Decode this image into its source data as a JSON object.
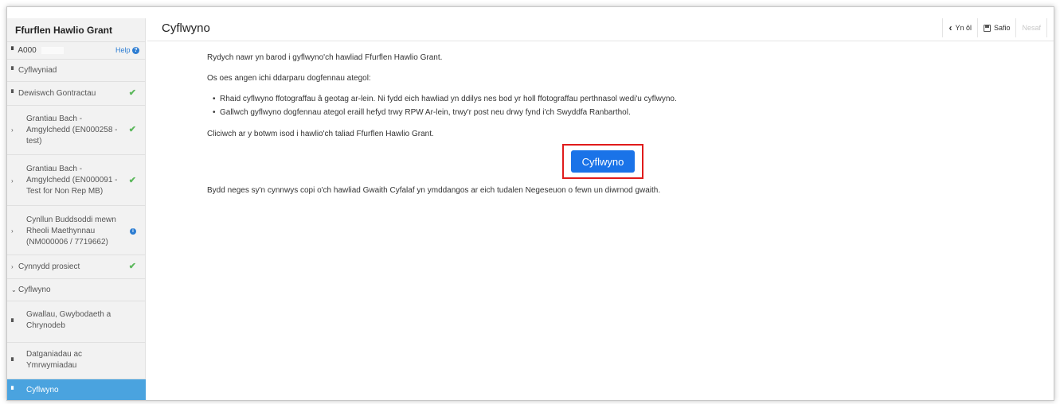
{
  "sidebar": {
    "title": "Ffurflen Hawlio Grant",
    "ref": "A000",
    "help": "Help",
    "items": [
      {
        "label": "Cyflwyniad",
        "status": ""
      },
      {
        "label": "Dewiswch Gontractau",
        "status": "complete"
      },
      {
        "label": "Grantiau Bach - Amgylchedd (EN000258 - test)",
        "status": "complete"
      },
      {
        "label": "Grantiau Bach - Amgylchedd (EN000091 - Test for Non Rep MB)",
        "status": "complete"
      },
      {
        "label": "Cynllun Buddsoddi mewn Rheoli Maethynnau (NM000006 / 7719662)",
        "status": "info"
      },
      {
        "label": "Cynnydd prosiect",
        "status": "complete"
      },
      {
        "label": "Cyflwyno",
        "status": ""
      },
      {
        "label": "Gwallau, Gwybodaeth a Chrynodeb",
        "status": ""
      },
      {
        "label": "Datganiadau ac Ymrwymiadau",
        "status": ""
      },
      {
        "label": "Cyflwyno",
        "status": "active"
      }
    ]
  },
  "header": {
    "title": "Cyflwyno",
    "back_label": "Yn ôl",
    "save_label": "Safio",
    "next_label": "Nesaf"
  },
  "content": {
    "intro": "Rydych nawr yn barod i gyflwyno'ch hawliad Ffurflen Hawlio Grant.",
    "docs_heading": "Os oes angen ichi ddarparu dogfennau ategol:",
    "bullets": [
      "Rhaid cyflwyno ffotograffau â geotag ar-lein. Ni fydd eich hawliad yn ddilys nes bod yr holl ffotograffau perthnasol wedi'u cyflwyno.",
      "Gallwch gyflwyno dogfennau ategol eraill hefyd trwy RPW Ar-lein, trwy'r post neu drwy fynd i'ch Swyddfa Ranbarthol."
    ],
    "click_text": "Cliciwch ar y botwm isod i hawlio'ch taliad Ffurflen Hawlio Grant.",
    "submit_label": "Cyflwyno",
    "footer_text": "Bydd neges sy'n cynnwys copi o'ch hawliad Gwaith Cyfalaf yn ymddangos ar eich tudalen Negeseuon o fewn un diwrnod gwaith."
  },
  "colors": {
    "primary": "#1a73e8",
    "highlight": "#e01b1b",
    "active_nav": "#4aa3df",
    "check": "#5cb85c"
  }
}
